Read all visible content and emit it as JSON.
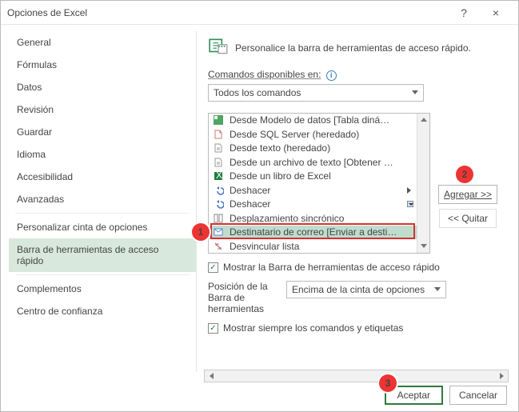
{
  "window": {
    "title": "Opciones de Excel",
    "help": "?",
    "close": "×"
  },
  "sidebar": {
    "items": [
      {
        "label": "General"
      },
      {
        "label": "Fórmulas"
      },
      {
        "label": "Datos"
      },
      {
        "label": "Revisión"
      },
      {
        "label": "Guardar"
      },
      {
        "label": "Idioma"
      },
      {
        "label": "Accesibilidad"
      },
      {
        "label": "Avanzadas"
      }
    ],
    "group2": [
      {
        "label": "Personalizar cinta de opciones"
      },
      {
        "label": "Barra de herramientas de acceso rápido"
      }
    ],
    "group3": [
      {
        "label": "Complementos"
      },
      {
        "label": "Centro de confianza"
      }
    ]
  },
  "main": {
    "heading": "Personalice la barra de herramientas de acceso rápido.",
    "commands_label": "Comandos disponibles en:",
    "commands_combo": "Todos los comandos",
    "list": [
      {
        "label": "Desde Modelo de datos [Tabla diná…"
      },
      {
        "label": "Desde SQL Server (heredado)"
      },
      {
        "label": "Desde texto (heredado)"
      },
      {
        "label": "Desde un archivo de texto [Obtener …"
      },
      {
        "label": "Desde un libro de Excel"
      },
      {
        "label": "Deshacer",
        "more": "caret"
      },
      {
        "label": "Deshacer",
        "more": "dd"
      },
      {
        "label": "Desplazamiento sincrónico"
      },
      {
        "label": "Destinatario de correo [Enviar a desti…"
      },
      {
        "label": "Desvincular lista"
      }
    ],
    "add_btn": "Agregar >>",
    "remove_btn": "<< Quitar",
    "show_label": "Mostrar la Barra de herramientas de acceso rápido",
    "pos_label": "Posición de la Barra de herramientas",
    "pos_combo": "Encima de la cinta de opciones",
    "always_label": "Mostrar siempre los comandos y etiquetas"
  },
  "footer": {
    "ok": "Aceptar",
    "cancel": "Cancelar"
  },
  "annotations": {
    "a1": "1",
    "a2": "2",
    "a3": "3"
  }
}
